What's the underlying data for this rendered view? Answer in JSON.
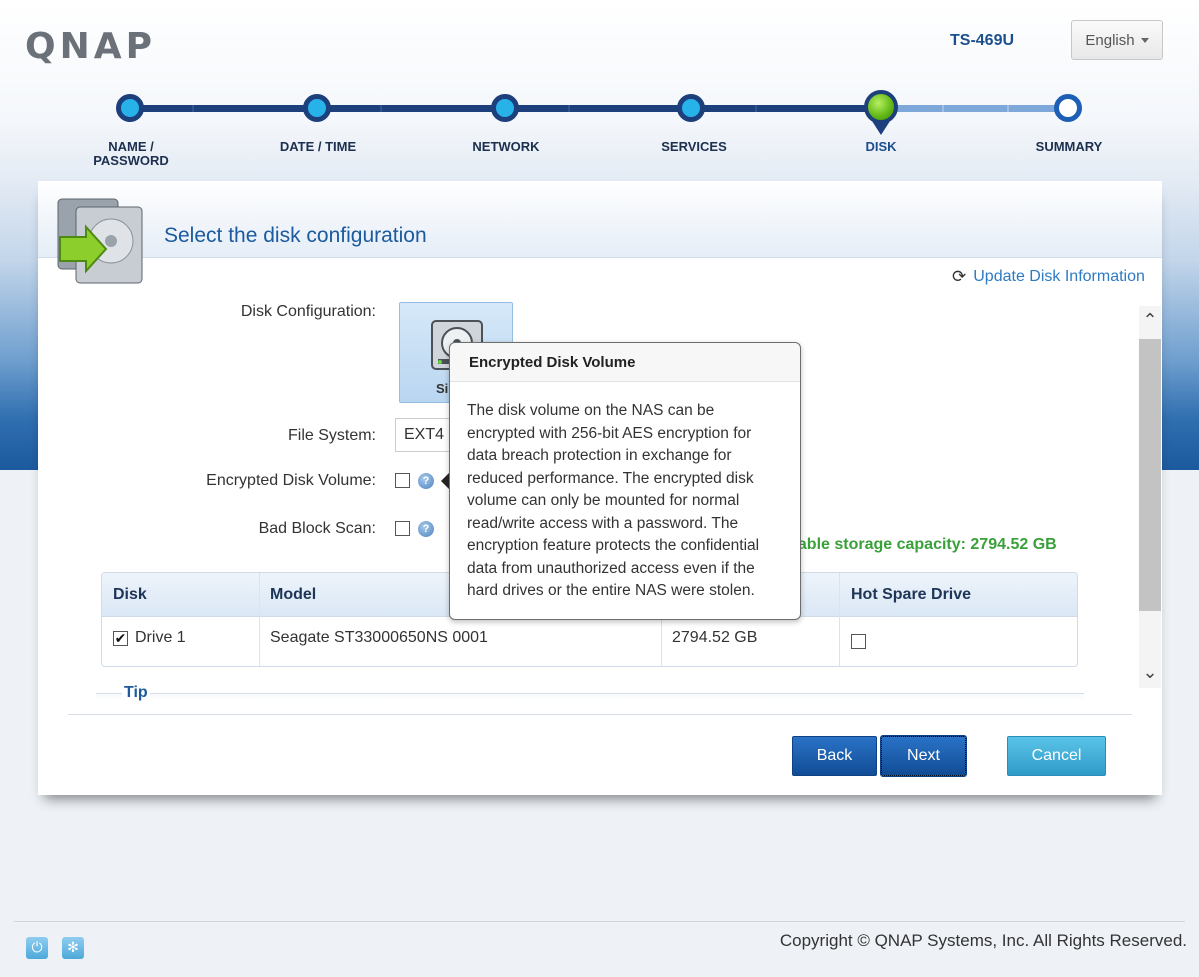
{
  "header": {
    "logo_text": "QNAP",
    "model": "TS-469U",
    "language": "English"
  },
  "steps": [
    {
      "label": "NAME / PASSWORD",
      "state": "done"
    },
    {
      "label": "DATE / TIME",
      "state": "done"
    },
    {
      "label": "NETWORK",
      "state": "done"
    },
    {
      "label": "SERVICES",
      "state": "done"
    },
    {
      "label": "DISK",
      "state": "current"
    },
    {
      "label": "SUMMARY",
      "state": "todo"
    }
  ],
  "panel": {
    "title": "Select the disk configuration",
    "update_link": "Update Disk Information",
    "disk_config_label": "Disk Configuration:",
    "disk_config_tile_label": "Si",
    "file_system_label": "File System:",
    "file_system_value": "EXT4",
    "encrypted_label": "Encrypted Disk Volume:",
    "bad_block_label": "Bad Block Scan:",
    "capacity_text": "ilable storage capacity: 2794.52 GB",
    "tip_label": "Tip"
  },
  "table": {
    "headers": [
      "Disk",
      "Model",
      "",
      "Hot Spare Drive"
    ],
    "rows": [
      {
        "disk": "Drive 1",
        "model": "Seagate ST33000650NS 0001",
        "capacity": "2794.52 GB",
        "checked": true,
        "hot_spare": false
      }
    ]
  },
  "buttons": {
    "back": "Back",
    "next": "Next",
    "cancel": "Cancel"
  },
  "tooltip": {
    "title": "Encrypted Disk Volume",
    "body": "The disk volume on the NAS can be encrypted with 256-bit AES encryption for data breach protection in exchange for reduced performance. The encrypted disk volume can only be mounted for normal read/write access with a password. The encryption feature protects the confidential data from unauthorized access even if the hard drives or the entire NAS were stolen."
  },
  "footer": {
    "copyright": "Copyright © QNAP Systems, Inc. All Rights Reserved."
  },
  "icons": {
    "refresh": "refresh-icon",
    "help": "help-icon",
    "power": "power-icon",
    "settings": "settings-icon"
  },
  "colors": {
    "accent_blue": "#1b5a9e",
    "step_done": "#27b2ea",
    "step_current": "#5fb514",
    "capacity_green": "#3aa03a"
  }
}
